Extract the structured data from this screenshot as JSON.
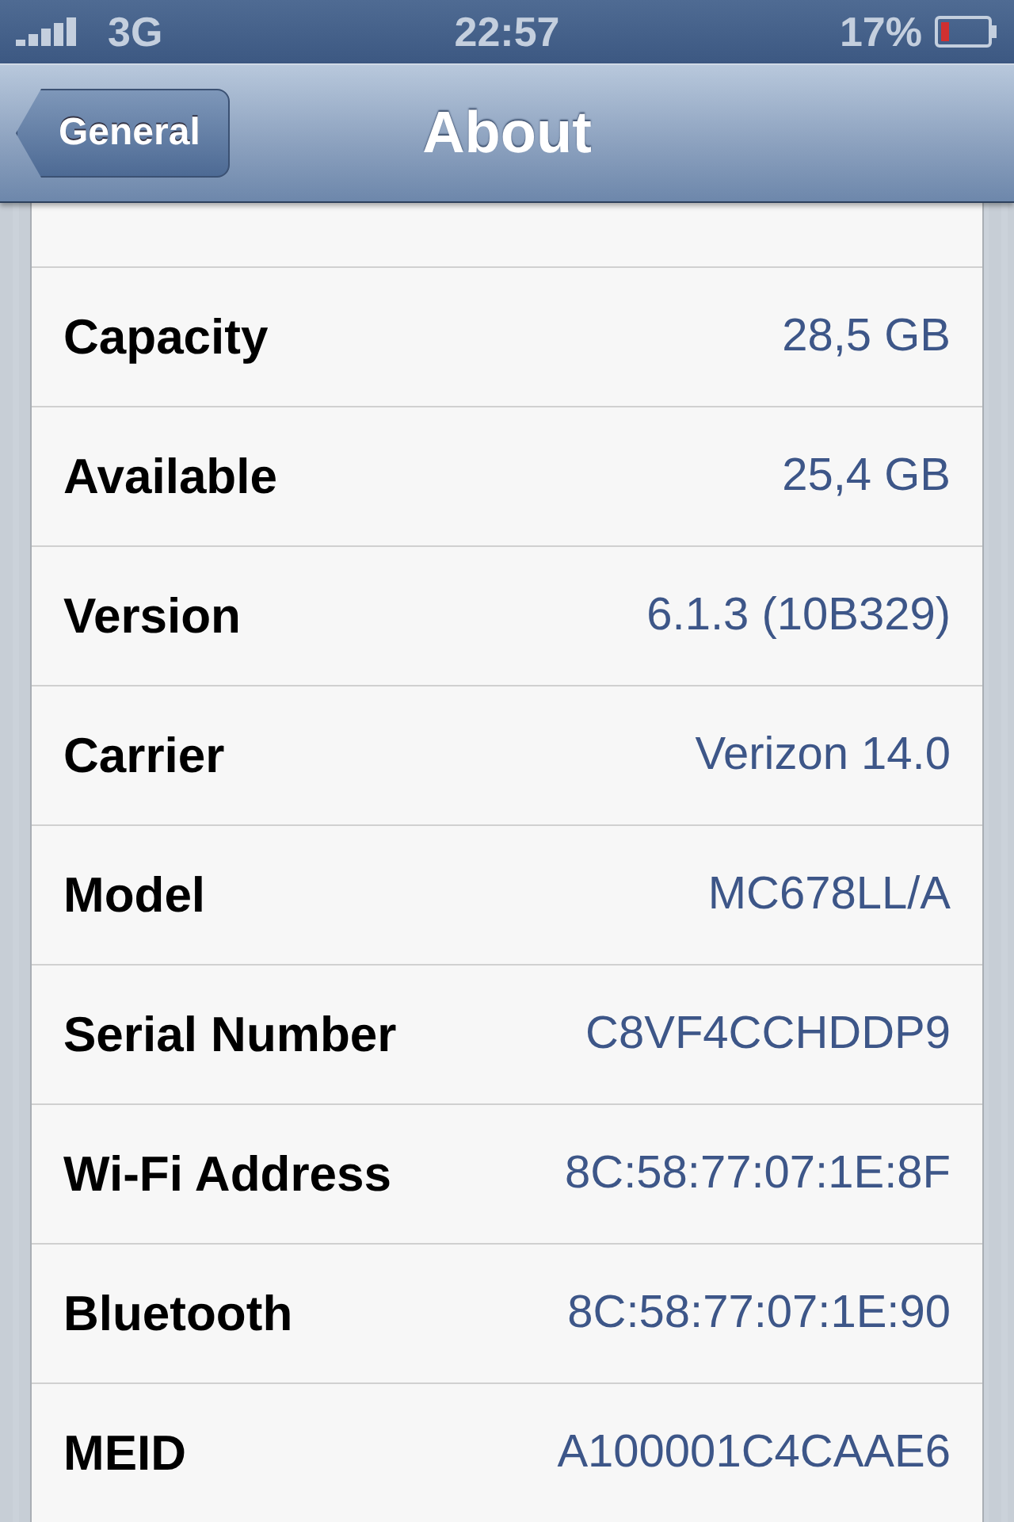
{
  "status_bar": {
    "carrier": "3G",
    "time": "22:57",
    "battery": "17%"
  },
  "nav_bar": {
    "back": "General",
    "title": "About"
  },
  "rows": [
    {
      "label": "Capacity",
      "value": "28,5 GB"
    },
    {
      "label": "Available",
      "value": "25,4 GB"
    },
    {
      "label": "Version",
      "value": "6.1.3 (10B329)"
    },
    {
      "label": "Carrier",
      "value": "Verizon 14.0"
    },
    {
      "label": "Model",
      "value": "MC678LL/A"
    },
    {
      "label": "Serial Number",
      "value": "C8VF4CCHDDP9"
    },
    {
      "label": "Wi-Fi Address",
      "value": "8C:58:77:07:1E:8F"
    },
    {
      "label": "Bluetooth",
      "value": "8C:58:77:07:1E:90"
    },
    {
      "label": "MEID",
      "value": "A100001C4CAAE6"
    }
  ]
}
